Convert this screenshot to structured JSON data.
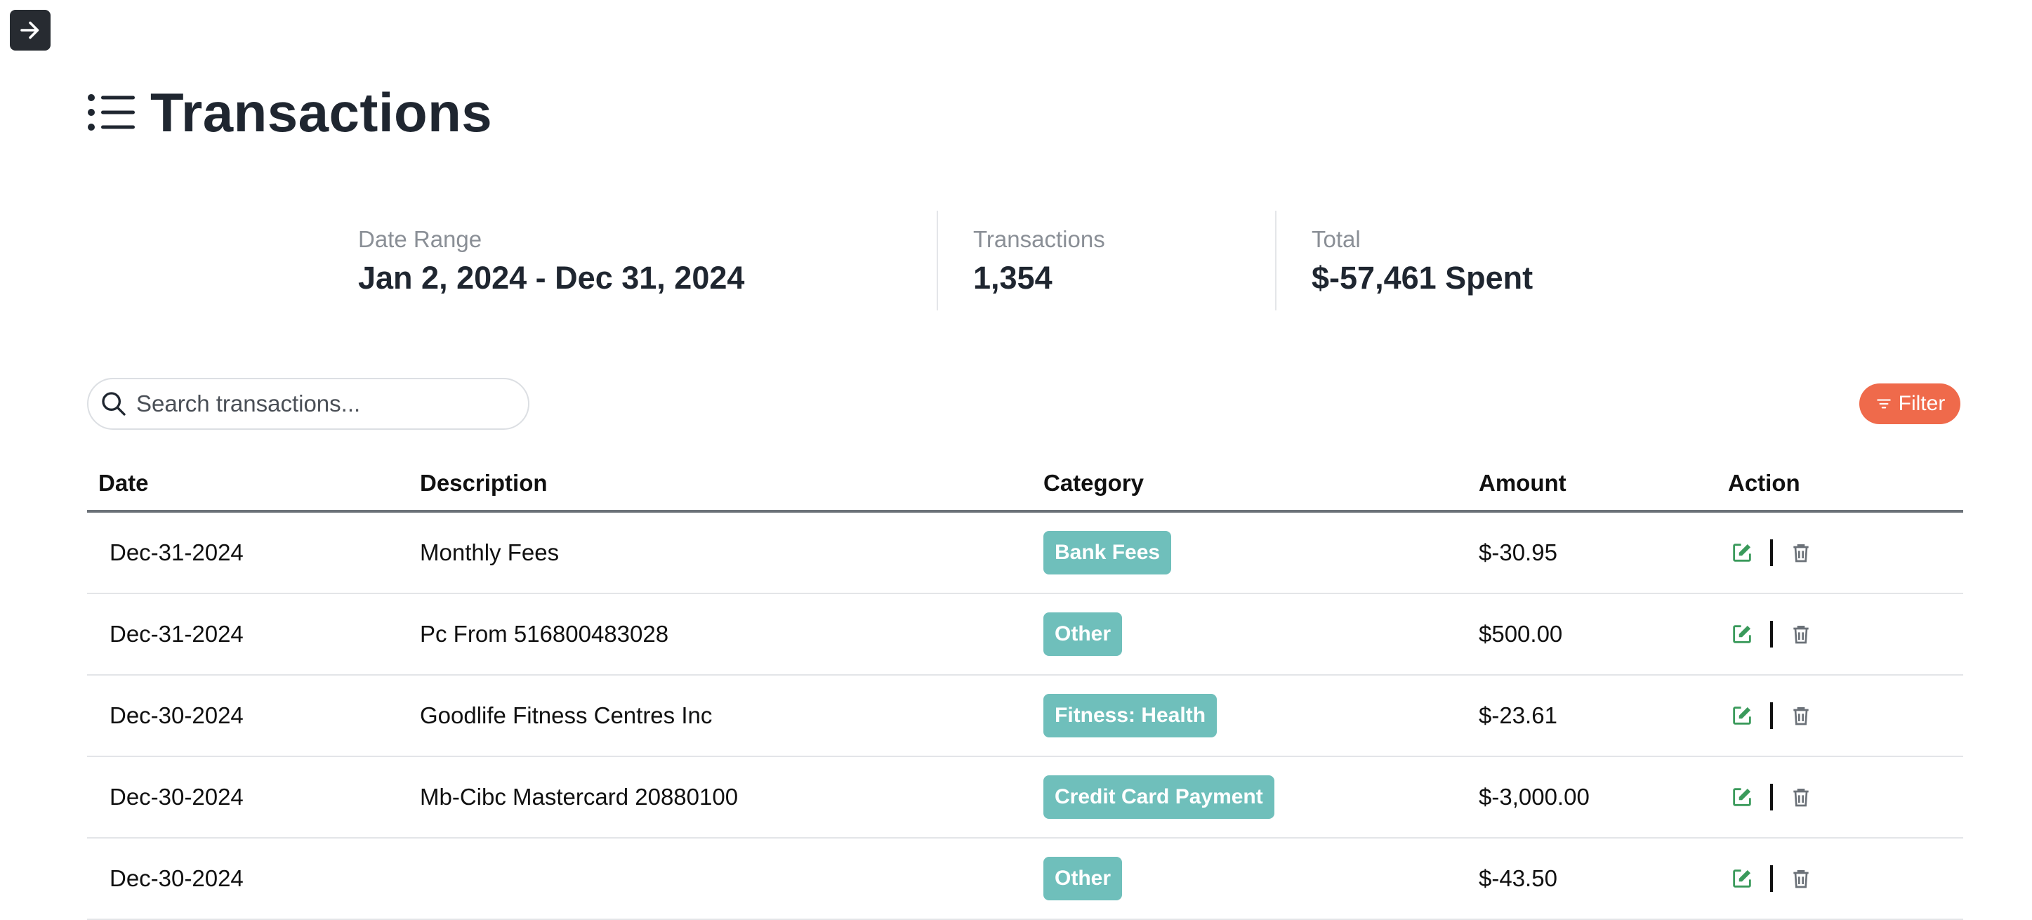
{
  "header": {
    "title": "Transactions",
    "expand_icon": "arrow-right-icon",
    "title_icon": "list-icon"
  },
  "stats": {
    "date_range": {
      "label": "Date Range",
      "value": "Jan 2, 2024 - Dec 31, 2024"
    },
    "transactions": {
      "label": "Transactions",
      "value": "1,354"
    },
    "total": {
      "label": "Total",
      "value": "$-57,461 Spent"
    }
  },
  "search": {
    "placeholder": "Search transactions...",
    "value": ""
  },
  "filter": {
    "label": "Filter",
    "color": "#ef6a4b"
  },
  "table": {
    "columns": {
      "date": "Date",
      "description": "Description",
      "category": "Category",
      "amount": "Amount",
      "action": "Action"
    },
    "rows": [
      {
        "date": "Dec-31-2024",
        "description": "Monthly Fees",
        "category": "Bank Fees",
        "amount": "$-30.95"
      },
      {
        "date": "Dec-31-2024",
        "description": "Pc From 516800483028",
        "category": "Other",
        "amount": "$500.00"
      },
      {
        "date": "Dec-30-2024",
        "description": "Goodlife Fitness Centres Inc",
        "category": "Fitness: Health",
        "amount": "$-23.61"
      },
      {
        "date": "Dec-30-2024",
        "description": "Mb-Cibc Mastercard 20880100",
        "category": "Credit Card Payment",
        "amount": "$-3,000.00"
      },
      {
        "date": "Dec-30-2024",
        "description": "",
        "category": "Other",
        "amount": "$-43.50"
      }
    ]
  },
  "colors": {
    "badge": "#6fbfbb",
    "edit_icon": "#3a9a5b",
    "delete_icon": "#6b7178",
    "dark": "#272b31"
  }
}
